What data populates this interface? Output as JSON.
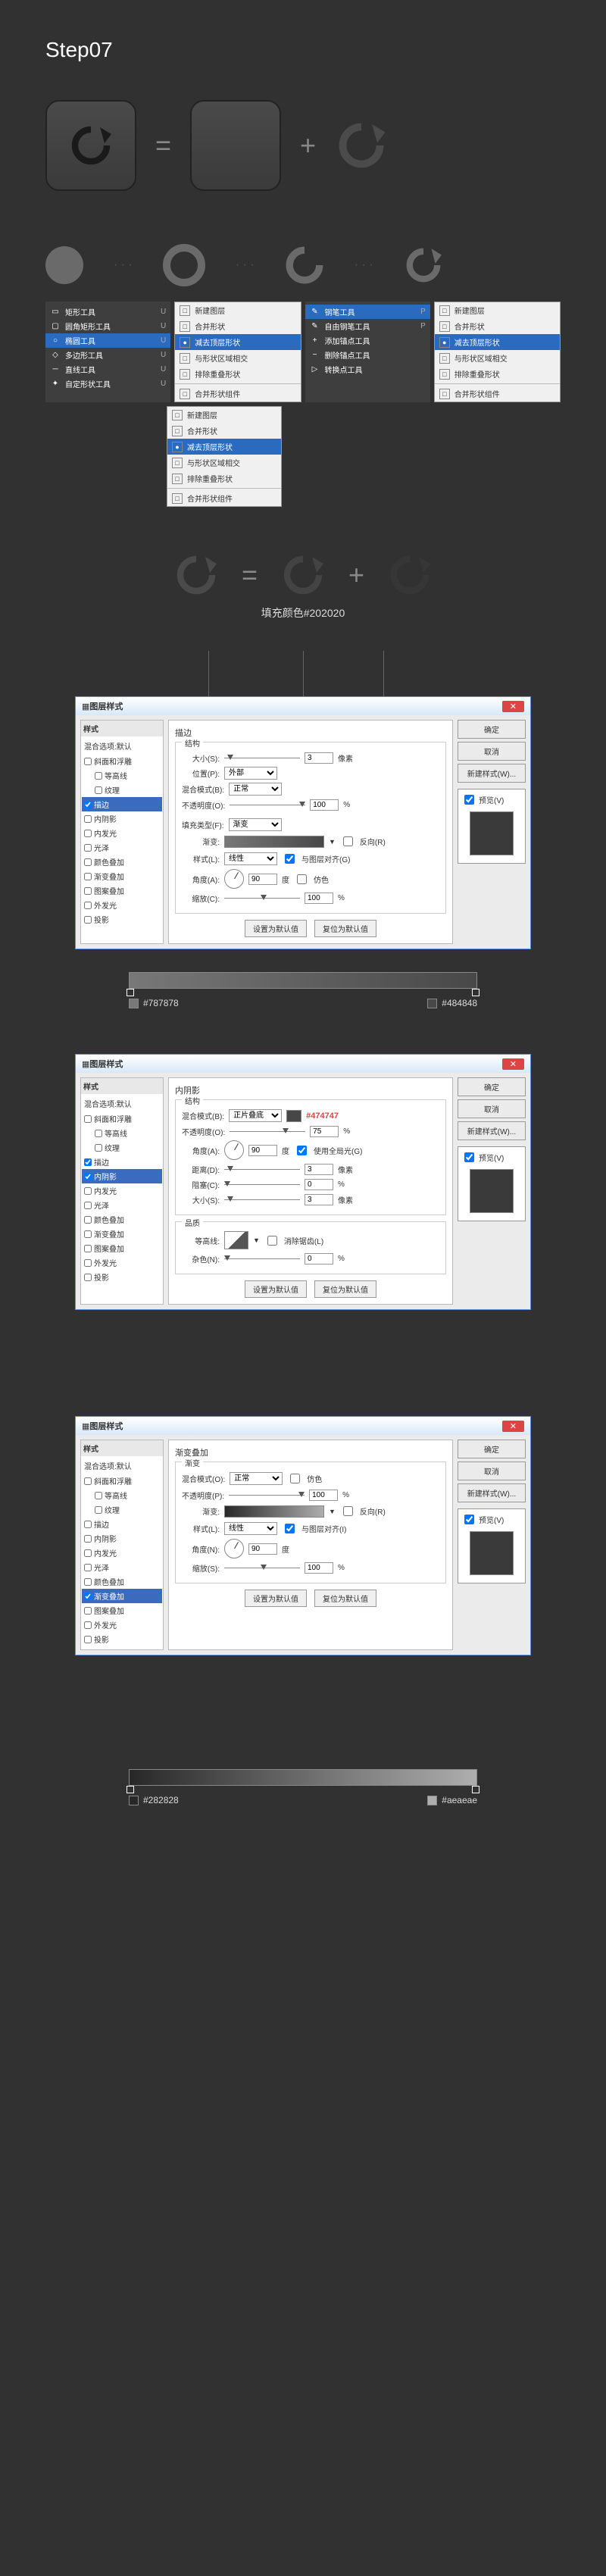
{
  "step": "Step07",
  "equation": {
    "equals": "=",
    "plus": "+"
  },
  "fill_label": "填充颜色#202020",
  "tool_panel1": {
    "items": [
      {
        "icon": "▭",
        "label": "矩形工具",
        "key": "U"
      },
      {
        "icon": "▢",
        "label": "圆角矩形工具",
        "key": "U"
      },
      {
        "icon": "○",
        "label": "椭圆工具",
        "key": "U",
        "hl": true
      },
      {
        "icon": "◇",
        "label": "多边形工具",
        "key": "U"
      },
      {
        "icon": "─",
        "label": "直线工具",
        "key": "U"
      },
      {
        "icon": "✦",
        "label": "自定形状工具",
        "key": "U"
      }
    ]
  },
  "tool_panel2": {
    "items": [
      {
        "icon": "✎",
        "label": "钢笔工具",
        "key": "P",
        "hl": true
      },
      {
        "icon": "✎",
        "label": "自由钢笔工具",
        "key": "P"
      },
      {
        "icon": "+",
        "label": "添加锚点工具",
        "key": ""
      },
      {
        "icon": "−",
        "label": "删除锚点工具",
        "key": ""
      },
      {
        "icon": "▷",
        "label": "转换点工具",
        "key": ""
      }
    ]
  },
  "menu_panel": {
    "items": [
      {
        "icon": "□",
        "label": "新建图层"
      },
      {
        "icon": "□",
        "label": "合并形状"
      },
      {
        "icon": "●",
        "label": "减去顶层形状",
        "hl": true
      },
      {
        "icon": "□",
        "label": "与形状区域相交"
      },
      {
        "icon": "□",
        "label": "排除重叠形状"
      },
      {
        "div": true
      },
      {
        "icon": "□",
        "label": "合并形状组件"
      }
    ]
  },
  "dialog": {
    "title": "图层样式",
    "ok": "确定",
    "cancel": "取消",
    "newstyle": "新建样式(W)...",
    "preview": "预览(V)",
    "side_header": "样式",
    "blend_default": "混合选项:默认",
    "side_items": [
      "斜面和浮雕",
      "等高线",
      "纹理",
      "描边",
      "内阴影",
      "内发光",
      "光泽",
      "颜色叠加",
      "渐变叠加",
      "图案叠加",
      "外发光",
      "投影"
    ],
    "btn_default": "设置为默认值",
    "btn_reset": "复位为默认值"
  },
  "dlg1": {
    "title": "描边",
    "grp1": "结构",
    "size": "大小(S):",
    "size_v": "3",
    "px": "像素",
    "pos": "位置(P):",
    "pos_v": "外部",
    "blend": "混合模式(B):",
    "blend_v": "正常",
    "opacity": "不透明度(O):",
    "opacity_v": "100",
    "pct": "%",
    "filltype": "填充类型(F):",
    "filltype_v": "渐变",
    "grad": "渐变:",
    "reverse": "反向(R)",
    "style": "样式(L):",
    "style_v": "线性",
    "align": "与图层对齐(G)",
    "angle": "角度(A):",
    "angle_v": "90",
    "dither": "仿色",
    "scale": "缩放(C):",
    "scale_v": "100"
  },
  "grad1": {
    "left": "#787878",
    "right": "#484848"
  },
  "dlg2": {
    "title": "内阴影",
    "grp1": "结构",
    "callout": "#474747",
    "blend": "混合模式(B):",
    "blend_v": "正片叠底",
    "opacity": "不透明度(O):",
    "opacity_v": "75",
    "pct": "%",
    "angle": "角度(A):",
    "angle_v": "90",
    "deg": "度",
    "global": "使用全局光(G)",
    "dist": "距离(D):",
    "dist_v": "3",
    "px": "像素",
    "choke": "阻塞(C):",
    "choke_v": "0",
    "size": "大小(S):",
    "size_v": "3",
    "grp2": "品质",
    "contour": "等高线:",
    "anti": "消除锯齿(L)",
    "noise": "杂色(N):",
    "noise_v": "0"
  },
  "dlg3": {
    "title": "渐变叠加",
    "grp1": "渐变",
    "blend": "混合模式(O):",
    "blend_v": "正常",
    "dither": "仿色",
    "opacity": "不透明度(P):",
    "opacity_v": "100",
    "pct": "%",
    "grad": "渐变:",
    "reverse": "反向(R)",
    "style": "样式(L):",
    "style_v": "线性",
    "align": "与图层对齐(I)",
    "angle": "角度(N):",
    "angle_v": "90",
    "deg": "度",
    "scale": "缩放(S):",
    "scale_v": "100"
  },
  "grad2": {
    "left": "#282828",
    "right": "#aeaeae"
  }
}
